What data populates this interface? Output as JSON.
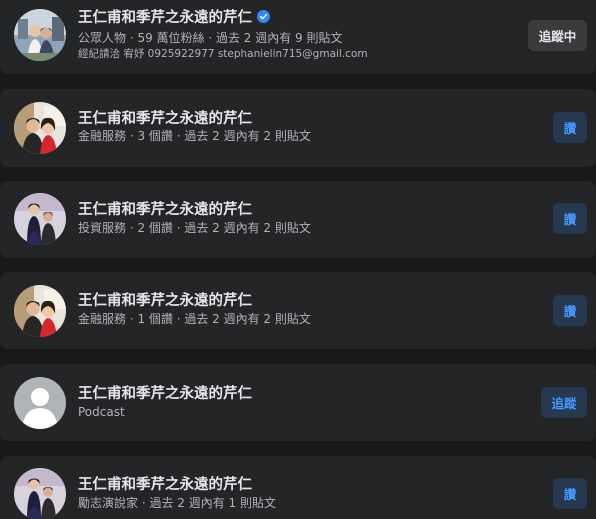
{
  "results": [
    {
      "name": "王仁甫和季芹之永遠的芹仁",
      "verified": true,
      "subtitle": "公眾人物 · 59 萬位粉絲 · 過去 2 週內有 9 則貼文",
      "detail": "經紀請洽 宥妤 0925922977 stephanielin715@gmail.com",
      "button": "追蹤中",
      "avatar": "photo-couple-outdoor"
    },
    {
      "name": "王仁甫和季芹之永遠的芹仁",
      "subtitle": "金融服務 · 3 個讚 · 過去 2 週內有 2 則貼文",
      "button": "讚",
      "avatar": "photo-couple-red"
    },
    {
      "name": "王仁甫和季芹之永遠的芹仁",
      "subtitle": "投資服務 · 2 個讚 · 過去 2 週內有 2 則貼文",
      "button": "讚",
      "avatar": "photo-couple-formal"
    },
    {
      "name": "王仁甫和季芹之永遠的芹仁",
      "subtitle": "金融服務 · 1 個讚 · 過去 2 週內有 2 則貼文",
      "button": "讚",
      "avatar": "photo-couple-red"
    },
    {
      "name": "王仁甫和季芹之永遠的芹仁",
      "subtitle": "Podcast",
      "button": "追蹤",
      "avatar": "default-avatar"
    },
    {
      "name": "王仁甫和季芹之永遠的芹仁",
      "subtitle": "勵志演說家 · 過去 2 週內有 1 則貼文",
      "button": "讚",
      "avatar": "photo-couple-formal"
    }
  ],
  "colors": {
    "background": "#18191a",
    "card": "#242526",
    "primary_text": "#e4e6eb",
    "secondary_text": "#b0b3b8",
    "accent_blue": "#4599ff",
    "blue_button_bg": "#263951",
    "gray_button_bg": "#3a3b3c",
    "verified_badge": "#2d88ff"
  }
}
